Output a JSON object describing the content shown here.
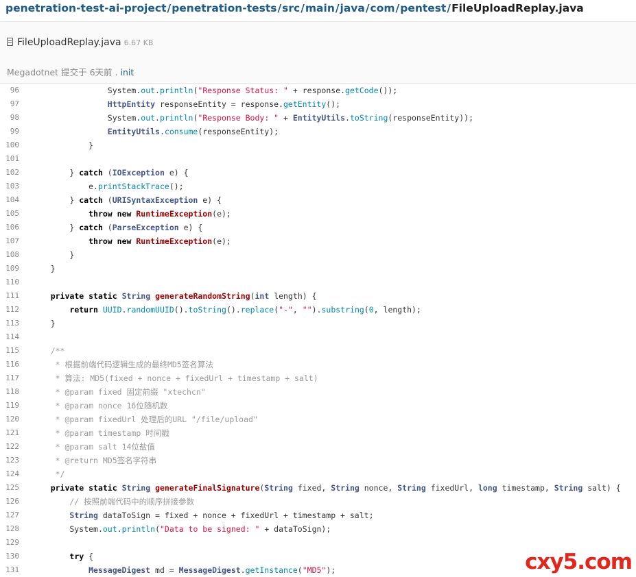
{
  "breadcrumb": [
    "penetration-test-ai-project",
    "penetration-tests",
    "src",
    "main",
    "java",
    "com",
    "pentest",
    "FileUploadReplay.java"
  ],
  "file": {
    "name": "FileUploadReplay.java",
    "size": "6.67 KB"
  },
  "commit": {
    "author": "Megadotnet",
    "action": "提交于",
    "time": "6天前",
    "dot": ".",
    "message": "init"
  },
  "watermark": "cxy5.com",
  "code_lines": [
    [
      96,
      [
        [
          "",
          "                System"
        ],
        [
          "",
          "."
        ],
        [
          "c",
          "out"
        ],
        [
          "",
          "."
        ],
        [
          "c",
          "println"
        ],
        [
          "",
          "("
        ],
        [
          "s",
          "\"Response Status: \""
        ],
        [
          "",
          " + response."
        ],
        [
          "c",
          "getCode"
        ],
        [
          "",
          "());"
        ]
      ]
    ],
    [
      97,
      [
        [
          "",
          "                "
        ],
        [
          "t",
          "HttpEntity"
        ],
        [
          "",
          " responseEntity = response."
        ],
        [
          "c",
          "getEntity"
        ],
        [
          "",
          "();"
        ]
      ]
    ],
    [
      98,
      [
        [
          "",
          "                System"
        ],
        [
          "",
          "."
        ],
        [
          "c",
          "out"
        ],
        [
          "",
          "."
        ],
        [
          "c",
          "println"
        ],
        [
          "",
          "("
        ],
        [
          "s",
          "\"Response Body: \""
        ],
        [
          "",
          " + "
        ],
        [
          "t",
          "EntityUtils"
        ],
        [
          "",
          "."
        ],
        [
          "c",
          "toString"
        ],
        [
          "",
          "(responseEntity));"
        ]
      ]
    ],
    [
      99,
      [
        [
          "",
          "                "
        ],
        [
          "t",
          "EntityUtils"
        ],
        [
          "",
          "."
        ],
        [
          "c",
          "consume"
        ],
        [
          "",
          "(responseEntity);"
        ]
      ]
    ],
    [
      100,
      [
        [
          "",
          "            }"
        ]
      ]
    ],
    [
      101,
      [
        [
          "",
          ""
        ]
      ]
    ],
    [
      102,
      [
        [
          "",
          "        } "
        ],
        [
          "k",
          "catch"
        ],
        [
          "",
          " ("
        ],
        [
          "t",
          "IOException"
        ],
        [
          "",
          " e) {"
        ]
      ]
    ],
    [
      103,
      [
        [
          "",
          "            e."
        ],
        [
          "c",
          "printStackTrace"
        ],
        [
          "",
          "();"
        ]
      ]
    ],
    [
      104,
      [
        [
          "",
          "        } "
        ],
        [
          "k",
          "catch"
        ],
        [
          "",
          " ("
        ],
        [
          "t",
          "URISyntaxException"
        ],
        [
          "",
          " e) {"
        ]
      ]
    ],
    [
      105,
      [
        [
          "",
          "            "
        ],
        [
          "k",
          "throw"
        ],
        [
          "",
          " "
        ],
        [
          "k",
          "new"
        ],
        [
          "",
          " "
        ],
        [
          "f",
          "RuntimeException"
        ],
        [
          "",
          "(e);"
        ]
      ]
    ],
    [
      106,
      [
        [
          "",
          "        } "
        ],
        [
          "k",
          "catch"
        ],
        [
          "",
          " ("
        ],
        [
          "t",
          "ParseException"
        ],
        [
          "",
          " e) {"
        ]
      ]
    ],
    [
      107,
      [
        [
          "",
          "            "
        ],
        [
          "k",
          "throw"
        ],
        [
          "",
          " "
        ],
        [
          "k",
          "new"
        ],
        [
          "",
          " "
        ],
        [
          "f",
          "RuntimeException"
        ],
        [
          "",
          "(e);"
        ]
      ]
    ],
    [
      108,
      [
        [
          "",
          "        }"
        ]
      ]
    ],
    [
      109,
      [
        [
          "",
          "    }"
        ]
      ]
    ],
    [
      110,
      [
        [
          "",
          ""
        ]
      ]
    ],
    [
      111,
      [
        [
          "",
          "    "
        ],
        [
          "k",
          "private"
        ],
        [
          "",
          " "
        ],
        [
          "k",
          "static"
        ],
        [
          "",
          " "
        ],
        [
          "t",
          "String"
        ],
        [
          "",
          " "
        ],
        [
          "f",
          "generateRandomString"
        ],
        [
          "",
          "("
        ],
        [
          "t",
          "int"
        ],
        [
          "",
          " length) {"
        ]
      ]
    ],
    [
      112,
      [
        [
          "",
          "        "
        ],
        [
          "k",
          "return"
        ],
        [
          "",
          " "
        ],
        [
          "c",
          "UUID"
        ],
        [
          "",
          "."
        ],
        [
          "c",
          "randomUUID"
        ],
        [
          "",
          "()."
        ],
        [
          "c",
          "toString"
        ],
        [
          "",
          "()."
        ],
        [
          "c",
          "replace"
        ],
        [
          "",
          "("
        ],
        [
          "s",
          "\"-\""
        ],
        [
          "",
          ", "
        ],
        [
          "s",
          "\"\""
        ],
        [
          "",
          ")."
        ],
        [
          "c",
          "substring"
        ],
        [
          "",
          "("
        ],
        [
          "n",
          "0"
        ],
        [
          "",
          ", length);"
        ]
      ]
    ],
    [
      113,
      [
        [
          "",
          "    }"
        ]
      ]
    ],
    [
      114,
      [
        [
          "",
          ""
        ]
      ]
    ],
    [
      115,
      [
        [
          "m",
          "    /**"
        ]
      ]
    ],
    [
      116,
      [
        [
          "m",
          "     * 根据前端代码逻辑生成的最终MD5签名算法"
        ]
      ]
    ],
    [
      117,
      [
        [
          "m",
          "     * 算法: MD5(fixed + nonce + fixedUrl + timestamp + salt)"
        ]
      ]
    ],
    [
      118,
      [
        [
          "m",
          "     * @param fixed 固定前缀 \"xtechcn\""
        ]
      ]
    ],
    [
      119,
      [
        [
          "m",
          "     * @param nonce 16位随机数"
        ]
      ]
    ],
    [
      120,
      [
        [
          "m",
          "     * @param fixedUrl 处理后的URL \"/file/upload\""
        ]
      ]
    ],
    [
      121,
      [
        [
          "m",
          "     * @param timestamp 时间戳"
        ]
      ]
    ],
    [
      122,
      [
        [
          "m",
          "     * @param salt 14位盐值"
        ]
      ]
    ],
    [
      123,
      [
        [
          "m",
          "     * @return MD5签名字符串"
        ]
      ]
    ],
    [
      124,
      [
        [
          "m",
          "     */"
        ]
      ]
    ],
    [
      125,
      [
        [
          "",
          "    "
        ],
        [
          "k",
          "private"
        ],
        [
          "",
          " "
        ],
        [
          "k",
          "static"
        ],
        [
          "",
          " "
        ],
        [
          "t",
          "String"
        ],
        [
          "",
          " "
        ],
        [
          "f",
          "generateFinalSignature"
        ],
        [
          "",
          "("
        ],
        [
          "t",
          "String"
        ],
        [
          "",
          " fixed, "
        ],
        [
          "t",
          "String"
        ],
        [
          "",
          " nonce, "
        ],
        [
          "t",
          "String"
        ],
        [
          "",
          " fixedUrl, "
        ],
        [
          "t",
          "long"
        ],
        [
          "",
          " timestamp, "
        ],
        [
          "t",
          "String"
        ],
        [
          "",
          " salt) {"
        ]
      ]
    ],
    [
      126,
      [
        [
          "m",
          "        // 按照前端代码中的顺序拼接参数"
        ]
      ]
    ],
    [
      127,
      [
        [
          "",
          "        "
        ],
        [
          "t",
          "String"
        ],
        [
          "",
          " dataToSign = fixed + nonce + fixedUrl + timestamp + salt;"
        ]
      ]
    ],
    [
      128,
      [
        [
          "",
          "        System"
        ],
        [
          "",
          "."
        ],
        [
          "c",
          "out"
        ],
        [
          "",
          "."
        ],
        [
          "c",
          "println"
        ],
        [
          "",
          "("
        ],
        [
          "s",
          "\"Data to be signed: \""
        ],
        [
          "",
          " + dataToSign);"
        ]
      ]
    ],
    [
      129,
      [
        [
          "",
          ""
        ]
      ]
    ],
    [
      130,
      [
        [
          "",
          "        "
        ],
        [
          "k",
          "try"
        ],
        [
          "",
          " {"
        ]
      ]
    ],
    [
      131,
      [
        [
          "",
          "            "
        ],
        [
          "t",
          "MessageDigest"
        ],
        [
          "",
          " md = "
        ],
        [
          "t",
          "MessageDigest"
        ],
        [
          "",
          "."
        ],
        [
          "c",
          "getInstance"
        ],
        [
          "",
          "("
        ],
        [
          "s",
          "\"MD5\""
        ],
        [
          "",
          ");"
        ]
      ]
    ]
  ]
}
